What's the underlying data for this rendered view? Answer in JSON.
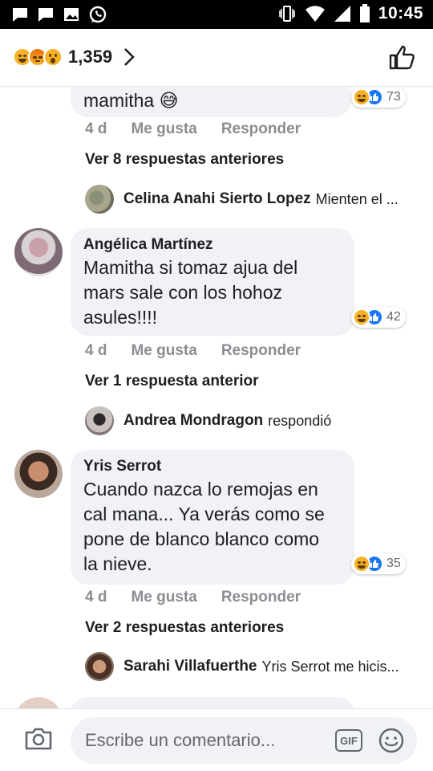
{
  "status_bar": {
    "time": "10:45",
    "icons": [
      "chat-notification-icon",
      "chat-notification-icon",
      "image-notification-icon",
      "whatsapp-icon",
      "vibrate-icon",
      "wifi-icon",
      "signal-icon",
      "battery-icon"
    ]
  },
  "reactions_header": {
    "emojis": [
      "haha",
      "angry",
      "wow"
    ],
    "count": "1,359",
    "chevron_icon": "chevron-right-icon",
    "like_icon": "thumbs-up-outline-icon"
  },
  "comments": [
    {
      "author": "",
      "text_lines": [
        "mamitha 😅"
      ],
      "reaction_count": "73",
      "time": "4 d",
      "like_label": "Me gusta",
      "reply_label": "Responder",
      "more_replies": "Ver 8 respuestas anteriores",
      "reply_preview": {
        "name": "Celina Anahi Sierto Lopez",
        "snippet": "Mienten el ..."
      }
    },
    {
      "author": "Angélica Martínez",
      "text_lines": [
        "Mamitha si tomaz ajua del",
        "mars sale con los hohoz",
        "asules!!!!"
      ],
      "reaction_count": "42",
      "time": "4 d",
      "like_label": "Me gusta",
      "reply_label": "Responder",
      "more_replies": "Ver 1 respuesta anterior",
      "reply_preview": {
        "name": "Andrea Mondragon",
        "snippet": "respondió"
      }
    },
    {
      "author": "Yris Serrot",
      "text_lines": [
        "Cuando nazca lo remojas en",
        "cal mana... Ya verás como se",
        "pone de blanco blanco como",
        "la nieve."
      ],
      "reaction_count": "35",
      "time": "4 d",
      "like_label": "Me gusta",
      "reply_label": "Responder",
      "more_replies": "Ver 2 respuestas anteriores",
      "reply_preview": {
        "name": "Sarahi Villafuerthe",
        "snippet": "Yris Serrot me hicis..."
      }
    }
  ],
  "composer": {
    "placeholder": "Escribe un comentario...",
    "camera_icon": "camera-icon",
    "gif_label": "GIF",
    "emoji_icon": "smiley-icon"
  }
}
